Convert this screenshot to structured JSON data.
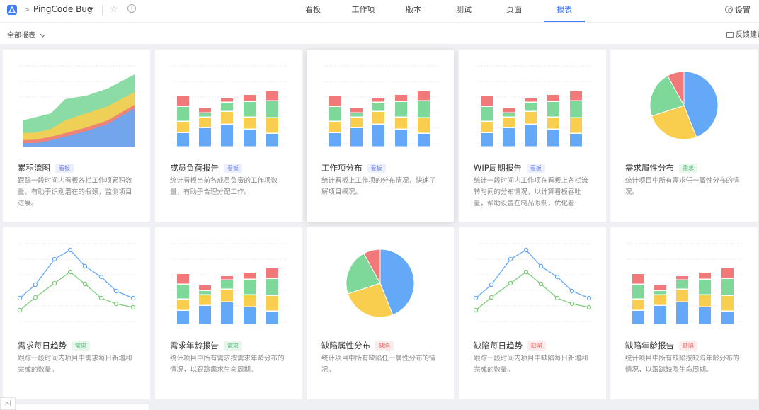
{
  "nav": {
    "project": "PingCode Bug",
    "tabs": [
      "看板",
      "工作项",
      "版本",
      "测试",
      "页面",
      "报表"
    ],
    "active_tab": "报表",
    "settings": "设置"
  },
  "subbar": {
    "filter": "全部报表",
    "feedback": "反馈建议"
  },
  "colors": {
    "accent": "#3d7dfe",
    "blue": "#64a9f8",
    "yellow": "#f9ce4e",
    "green": "#7ed89a",
    "red": "#f1797a"
  },
  "cards": [
    {
      "title": "累积流图",
      "tag": "看板",
      "tag_type": "board",
      "thumb": "area",
      "desc": "跟踪一段时间内看板各栏工作项累积数量，有助于识别潜在的瓶颈，监测项目进展。"
    },
    {
      "title": "成员负荷报告",
      "tag": "看板",
      "tag_type": "board",
      "thumb": "bars",
      "desc": "统计看板当前各成员负责的工作项数量，有助于合理分配工作。"
    },
    {
      "title": "工作项分布",
      "tag": "看板",
      "tag_type": "board",
      "thumb": "bars",
      "desc": "统计看板上工作项的分布情况，快速了解项目概况。"
    },
    {
      "title": "WIP周期报告",
      "tag": "看板",
      "tag_type": "board",
      "thumb": "bars",
      "desc": "统计一段时间内工作项在看板上各栏流转时间的分布情况，以计算看板吞吐量，帮助设置在制品限制，优化看"
    },
    {
      "title": "需求属性分布",
      "tag": "需求",
      "tag_type": "req",
      "thumb": "pie",
      "desc": "统计项目中所有需求任一属性分布的情况。"
    },
    {
      "title": "需求每日趋势",
      "tag": "需求",
      "tag_type": "req",
      "thumb": "line",
      "desc": "跟踪一段时间内项目中需求每日新增和完成的数量。"
    },
    {
      "title": "需求年龄报告",
      "tag": "需求",
      "tag_type": "req",
      "thumb": "bars",
      "desc": "统计项目中所有需求按需求年龄分布的情况，以跟踪需求生命周期。"
    },
    {
      "title": "缺陷属性分布",
      "tag": "缺陷",
      "tag_type": "bug",
      "thumb": "pie",
      "desc": "统计项目中所有缺陷任一属性分布的情况。"
    },
    {
      "title": "缺陷每日趋势",
      "tag": "缺陷",
      "tag_type": "bug",
      "thumb": "line",
      "desc": "跟踪一段时间内项目中缺陷每日新增和完成的数量。"
    },
    {
      "title": "缺陷年龄报告",
      "tag": "缺陷",
      "tag_type": "bug",
      "thumb": "bars",
      "desc": "统计项目中所有缺陷按缺陷年龄分布的情况，以跟踪缺陷生命周期。"
    }
  ]
}
